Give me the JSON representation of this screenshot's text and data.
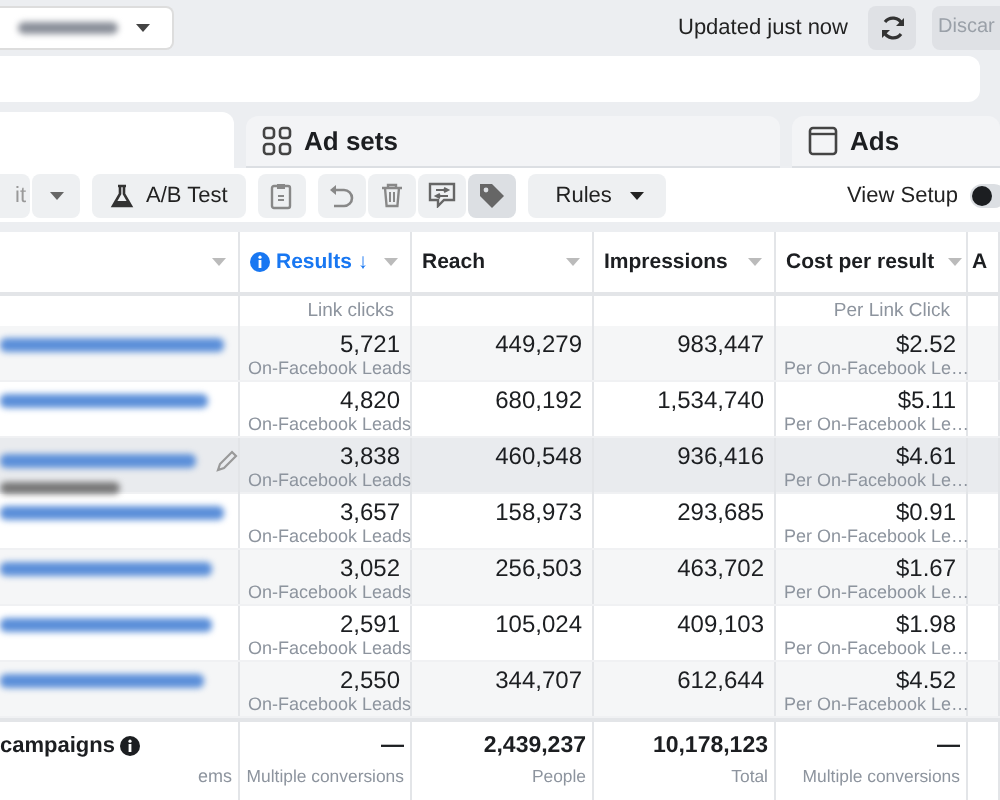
{
  "top_bar": {
    "update_status": "Updated just now",
    "discard_button": "Discar"
  },
  "tabs": [
    {
      "kind": "campaigns",
      "selected": true
    },
    {
      "kind": "ad-sets",
      "label": "Ad sets",
      "selected": false
    },
    {
      "kind": "ads",
      "label": "Ads",
      "selected": false
    }
  ],
  "toolbar": {
    "items": [
      {
        "kind": "edit",
        "label": "it"
      },
      {
        "kind": "more"
      },
      {
        "kind": "ab-test",
        "label": "A/B Test"
      },
      {
        "kind": "duplicate"
      },
      {
        "kind": "undo"
      },
      {
        "kind": "delete"
      },
      {
        "kind": "swap"
      },
      {
        "kind": "tag"
      },
      {
        "kind": "rules",
        "label": "Rules"
      }
    ],
    "view_setup": {
      "label": "View Setup",
      "on": false
    }
  },
  "table": {
    "columns": [
      {
        "menu": true,
        "sorted": false
      },
      {
        "menu": true,
        "label": "Results",
        "sorted": true,
        "sort_arrow": "↓",
        "unit": "Link clicks"
      },
      {
        "menu": true,
        "label": "Reach",
        "sorted": false
      },
      {
        "menu": true,
        "label": "Impressions",
        "sorted": false
      },
      {
        "menu": true,
        "label": "Cost per result",
        "sorted": false,
        "unit": "Per Link Click"
      },
      {
        "label": "A",
        "sorted": false
      }
    ],
    "rows": [
      {
        "highlighted": false,
        "results": "5,721",
        "results_type": "On-Facebook Leads",
        "reach": "449,279",
        "impressions": "983,447",
        "cost": "$2.52",
        "cost_type": "Per On-Facebook Le…"
      },
      {
        "highlighted": false,
        "results": "4,820",
        "results_type": "On-Facebook Leads",
        "reach": "680,192",
        "impressions": "1,534,740",
        "cost": "$5.11",
        "cost_type": "Per On-Facebook Le…"
      },
      {
        "highlighted": true,
        "results": "3,838",
        "results_type": "On-Facebook Leads",
        "reach": "460,548",
        "impressions": "936,416",
        "cost": "$4.61",
        "cost_type": "Per On-Facebook Le…"
      },
      {
        "highlighted": false,
        "results": "3,657",
        "results_type": "On-Facebook Leads",
        "reach": "158,973",
        "impressions": "293,685",
        "cost": "$0.91",
        "cost_type": "Per On-Facebook Le…"
      },
      {
        "highlighted": false,
        "results": "3,052",
        "results_type": "On-Facebook Leads",
        "reach": "256,503",
        "impressions": "463,702",
        "cost": "$1.67",
        "cost_type": "Per On-Facebook Le…"
      },
      {
        "highlighted": false,
        "results": "2,591",
        "results_type": "On-Facebook Leads",
        "reach": "105,024",
        "impressions": "409,103",
        "cost": "$1.98",
        "cost_type": "Per On-Facebook Le…"
      },
      {
        "highlighted": false,
        "results": "2,550",
        "results_type": "On-Facebook Leads",
        "reach": "344,707",
        "impressions": "612,644",
        "cost": "$4.52",
        "cost_type": "Per On-Facebook Le…"
      }
    ],
    "footer": {
      "title": "campaigns",
      "subtitle": "ems",
      "results": "—",
      "results_note": "Multiple conversions",
      "reach": "2,439,237",
      "reach_note": "People",
      "impressions": "10,178,123",
      "impressions_note": "Total",
      "cost": "—",
      "cost_note": "Multiple conversions"
    }
  }
}
